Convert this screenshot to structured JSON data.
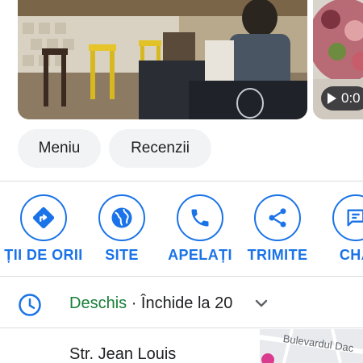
{
  "photos": {
    "video_duration": "0:0"
  },
  "chips": {
    "menu": "Meniu",
    "reviews": "Recenzii"
  },
  "actions": [
    {
      "label": "ȚII DE ORII",
      "icon": "directions-icon"
    },
    {
      "label": "SITE",
      "icon": "globe-icon"
    },
    {
      "label": "APELAȚI",
      "icon": "phone-icon"
    },
    {
      "label": "TRIMITE",
      "icon": "share-icon"
    },
    {
      "label": "CHA",
      "icon": "chat-icon"
    }
  ],
  "hours": {
    "status": "Deschis",
    "separator": " · ",
    "closes": "Închide la 20"
  },
  "address": {
    "line": "Str. Jean Louis"
  },
  "map": {
    "street_label": "Bulevardul Dac"
  },
  "colors": {
    "accent": "#1a73e8",
    "open": "#188038",
    "text": "#202124",
    "chip_bg": "#f1f3f4",
    "divider": "#dadce0"
  }
}
